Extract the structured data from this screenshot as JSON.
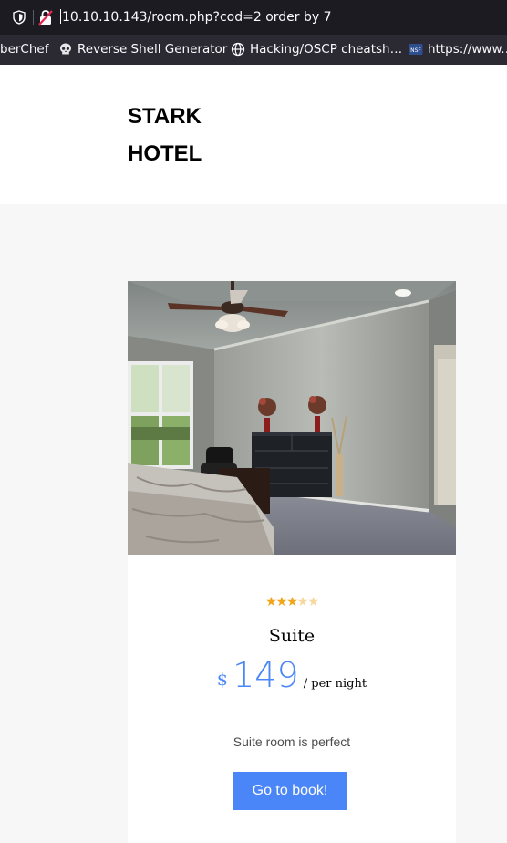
{
  "browser": {
    "url": "10.10.10.143/room.php?cod=2 order by 7",
    "bookmarks": [
      {
        "label": "berChef",
        "icon": "cyberchef-icon"
      },
      {
        "label": "Reverse Shell Generator",
        "icon": "skull-icon"
      },
      {
        "label": "Hacking/OSCP cheatsh…",
        "icon": "globe-icon"
      },
      {
        "label": "https://www.…",
        "icon": "nsf-icon"
      }
    ]
  },
  "header": {
    "brand_line1": "STARK",
    "brand_line2": "HOTEL"
  },
  "room": {
    "rating": 3,
    "rating_max": 5,
    "name": "Suite",
    "currency": "$",
    "price": "149",
    "per_night": "/ per night",
    "description": "Suite room is perfect",
    "book_label": "Go to book!"
  },
  "colors": {
    "accent": "#4a86f7",
    "star": "#f2a51a",
    "chrome_bg": "#1c1b22"
  }
}
